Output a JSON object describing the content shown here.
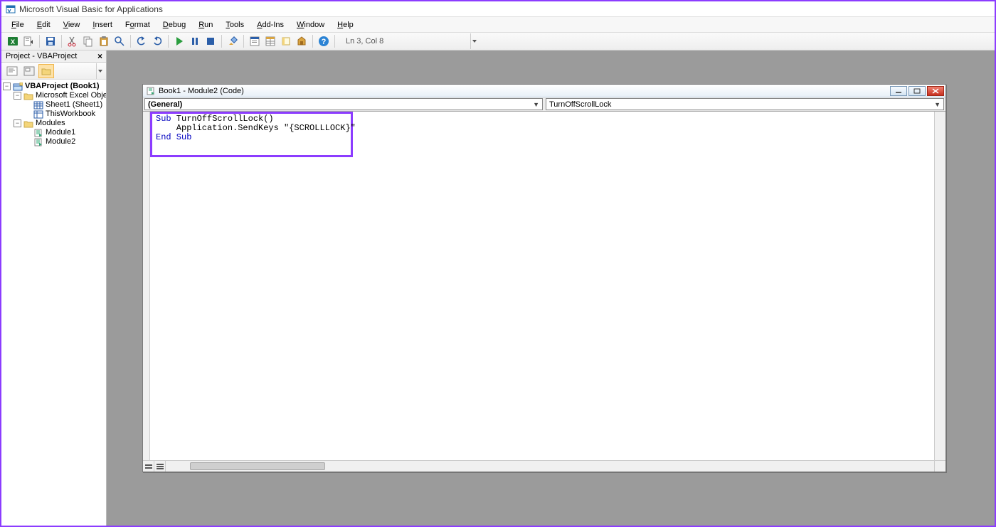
{
  "title": "Microsoft Visual Basic for Applications",
  "menu": {
    "file": "File",
    "edit": "Edit",
    "view": "View",
    "insert": "Insert",
    "format": "Format",
    "debug": "Debug",
    "run": "Run",
    "tools": "Tools",
    "addins": "Add-Ins",
    "window": "Window",
    "help": "Help"
  },
  "toolbar": {
    "status": "Ln 3, Col 8"
  },
  "project_panel": {
    "title": "Project - VBAProject",
    "root": "VBAProject (Book1)",
    "folder_objects": "Microsoft Excel Objects",
    "sheet1": "Sheet1 (Sheet1)",
    "thisworkbook": "ThisWorkbook",
    "folder_modules": "Modules",
    "module1": "Module1",
    "module2": "Module2"
  },
  "code_window": {
    "title": "Book1 - Module2 (Code)",
    "left_dropdown": "(General)",
    "right_dropdown": "TurnOffScrollLock",
    "code": {
      "l1_kw": "Sub",
      "l1_rest": " TurnOffScrollLock()",
      "l2": "    Application.SendKeys \"{SCROLLLOCK}\"",
      "l3_kw": "End Sub"
    }
  }
}
